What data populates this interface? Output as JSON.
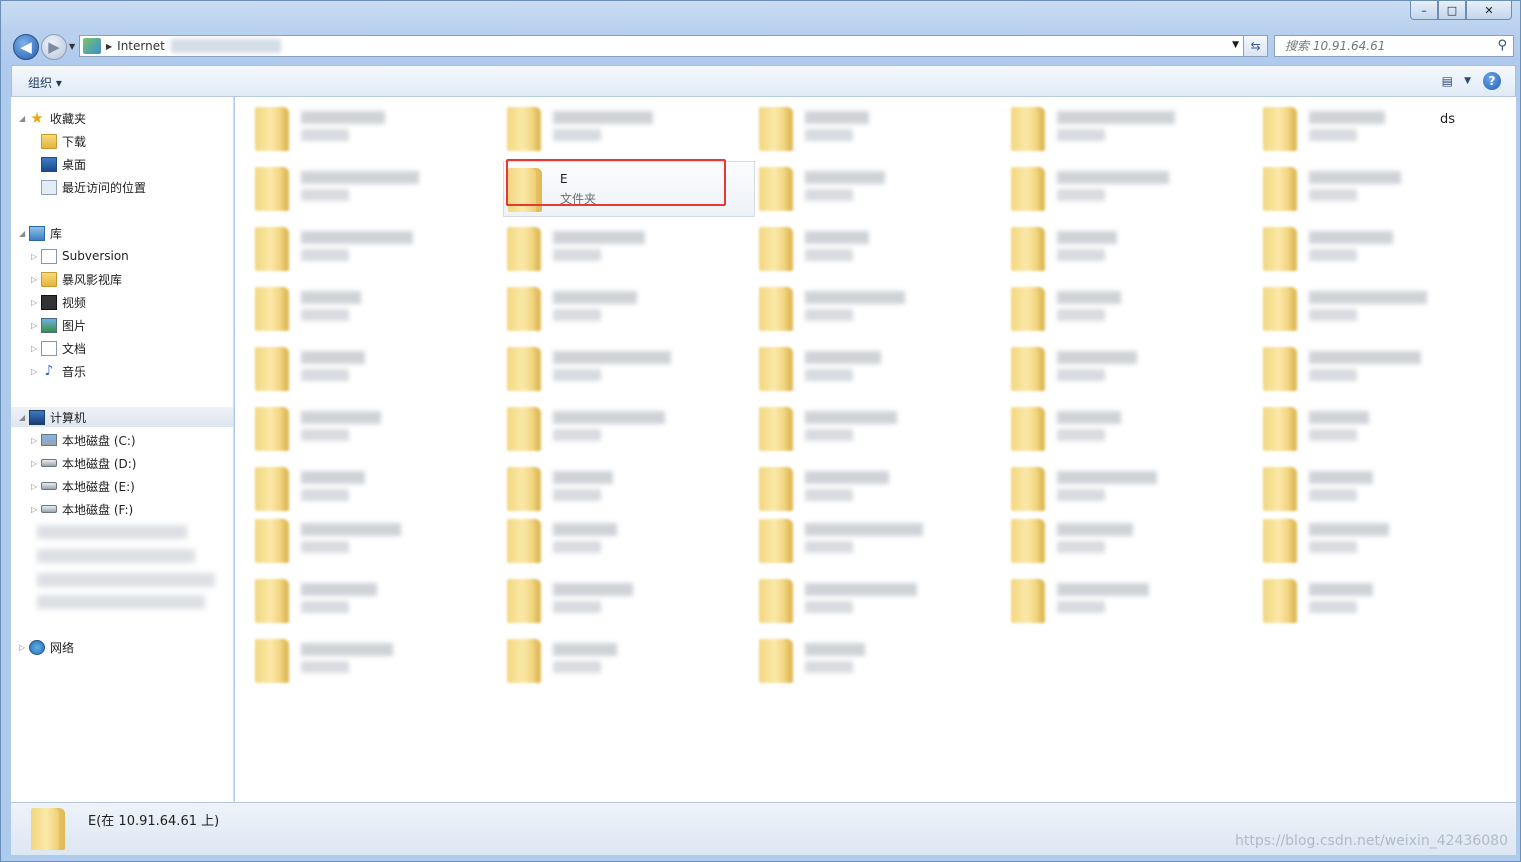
{
  "address": {
    "location": "Internet"
  },
  "search": {
    "placeholder": "搜索 10.91.64.61"
  },
  "toolbar": {
    "organize": "组织 ▾"
  },
  "sidebar": {
    "favorites": {
      "label": "收藏夹",
      "items": [
        "下载",
        "桌面",
        "最近访问的位置"
      ]
    },
    "libraries": {
      "label": "库",
      "items": [
        "Subversion",
        "暴风影视库",
        "视频",
        "图片",
        "文档",
        "音乐"
      ]
    },
    "computer": {
      "label": "计算机",
      "items": [
        "本地磁盘 (C:)",
        "本地磁盘 (D:)",
        "本地磁盘 (E:)",
        "本地磁盘 (F:)"
      ]
    },
    "network": {
      "label": "网络"
    }
  },
  "content": {
    "selected_item": {
      "name": "E",
      "type": "文件夹"
    },
    "partial_text": "ds"
  },
  "status": {
    "text": "E(在 10.91.64.61 上)"
  },
  "watermark": "https://blog.csdn.net/weixin_42436080"
}
